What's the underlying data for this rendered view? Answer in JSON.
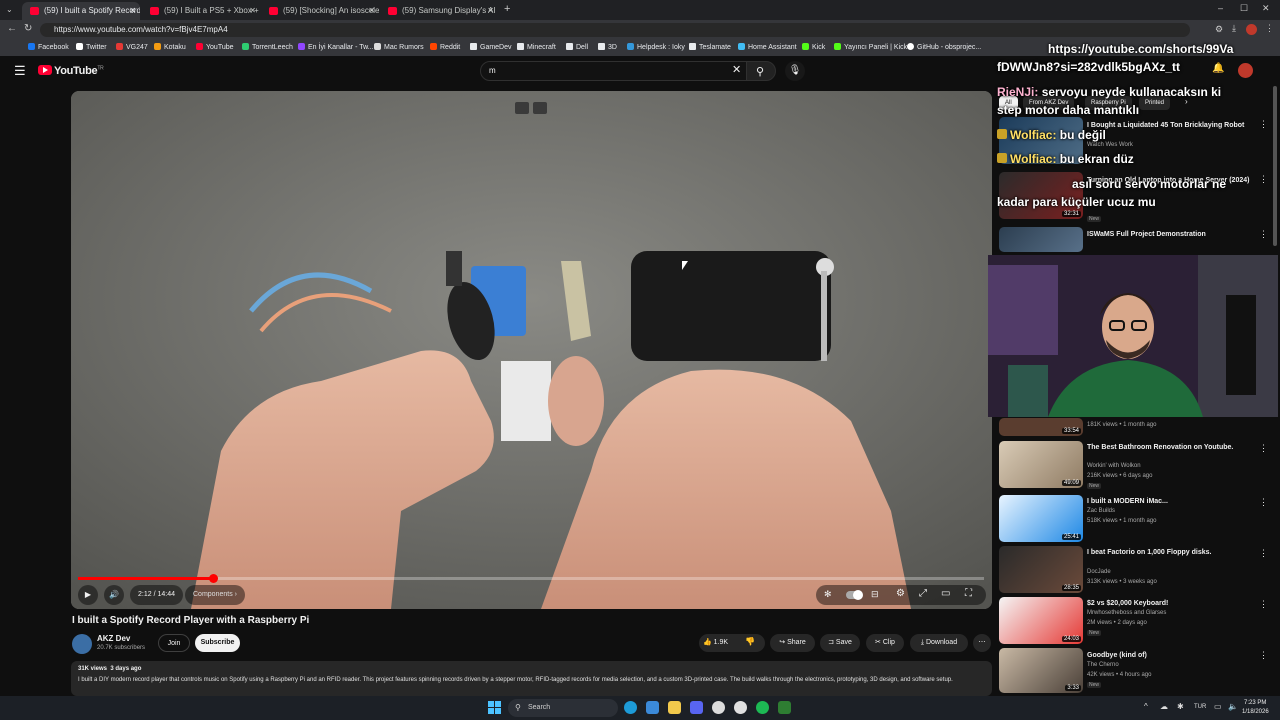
{
  "browser": {
    "tabs": [
      {
        "title": "(59) I built a Spotify Record Player"
      },
      {
        "title": "(59) I Built a PS5 + Xbox + Switch"
      },
      {
        "title": "(59) [Shocking] An isosceles trian..."
      },
      {
        "title": "(59) Samsung Display's AI Cassett..."
      }
    ],
    "url": "https://www.youtube.com/watch?v=fBjv4E7mpA4",
    "bookmarks": [
      "Facebook",
      "Twitter",
      "VG247",
      "Kotaku",
      "YouTube",
      "TorrentLeech",
      "En İyi Kanallar - Tw...",
      "Mac Rumors",
      "Reddit",
      "GameDev",
      "Minecraft",
      "Dell",
      "3D",
      "Helpdesk : Ioky",
      "Teslamate",
      "Home Assistant",
      "Kick",
      "Yayıncı Paneli | Kick",
      "GitHub - obsprojec..."
    ]
  },
  "youtube": {
    "logo": "YouTube",
    "logo_sup": "TR",
    "search_value": "m"
  },
  "video": {
    "current_time": "2:12 / 14:44",
    "chapter": "Components",
    "progress": 0.149,
    "title": "I built a Spotify Record Player with a Raspberry Pi",
    "channel": "AKZ Dev",
    "subscribers": "20.7K subscribers",
    "join": "Join",
    "subscribe": "Subscribe",
    "likes": "1.9K",
    "share": "Share",
    "save": "Save",
    "clip": "Clip",
    "download": "Download",
    "views_date": "31K views  3 days ago",
    "description": "I built a DIY modern record player that controls music on Spotify using a Raspberry Pi and an RFID reader. This project features spinning records driven by a stepper motor, RFID-tagged records for media selection, and a custom 3D-printed case. The build walks through the electronics, prototyping, 3D design, and software setup."
  },
  "sidebar": {
    "chips": [
      "All",
      "From AKZ Dev",
      "Raspberry Pi",
      "Printed"
    ],
    "items": [
      {
        "title": "I Bought a Liquidated 45 Ton Bricklaying Robot",
        "channel": "Watch Wes Work",
        "meta": "",
        "duration": "",
        "new": ""
      },
      {
        "title": "Turning an Old Laptop into a Home Server (2024)",
        "channel": "",
        "meta": "",
        "duration": "32:31",
        "new": "New"
      },
      {
        "title": "ISWaMS Full Project Demonstration",
        "channel": "",
        "meta": "",
        "duration": "",
        "new": ""
      },
      {
        "title": "",
        "channel": "",
        "meta": "181K views • 1 month ago",
        "duration": "33:54",
        "new": ""
      },
      {
        "title": "The Best Bathroom Renovation on Youtube.",
        "channel": "Workin' with Wolkon",
        "meta": "216K views • 6 days ago",
        "duration": "49:09",
        "new": "New"
      },
      {
        "title": "I built a MODERN iMac...",
        "channel": "Zac Builds",
        "meta": "518K views • 1 month ago",
        "duration": "25:41",
        "new": ""
      },
      {
        "title": "I beat Factorio on 1,000 Floppy disks.",
        "channel": "DocJade",
        "meta": "313K views • 3 weeks ago",
        "duration": "28:35",
        "new": ""
      },
      {
        "title": "$2 vs $20,000 Keyboard!",
        "channel": "Mrwhosetheboss and Glarses",
        "meta": "2M views • 2 days ago",
        "duration": "24:03",
        "new": "New"
      },
      {
        "title": "Goodbye (kind of)",
        "channel": "The Cherno",
        "meta": "42K views • 4 hours ago",
        "duration": "3:33",
        "new": "New"
      }
    ]
  },
  "chat": {
    "line1": "https://youtube.com/shorts/99Va",
    "line2": "fDWWJn8?si=282vdlk5bgAXz_tt",
    "m1_name": "RieNJi:",
    "m1_text": "servoyu neyde kullanacaksın ki",
    "m1_text2": "step motor daha mantıklı",
    "m2_name": "Wolfiac:",
    "m2_text": "bu değil",
    "m3_name": "Wolfiac:",
    "m3_text": "bu ekran düz",
    "m4_text": "asıl soru servo motorlar ne",
    "m4_text2": "kadar para küçüler ucuz mu"
  },
  "taskbar": {
    "search": "Search",
    "lang": "TUR",
    "time": "7:23 PM",
    "date": "1/18/2026"
  }
}
